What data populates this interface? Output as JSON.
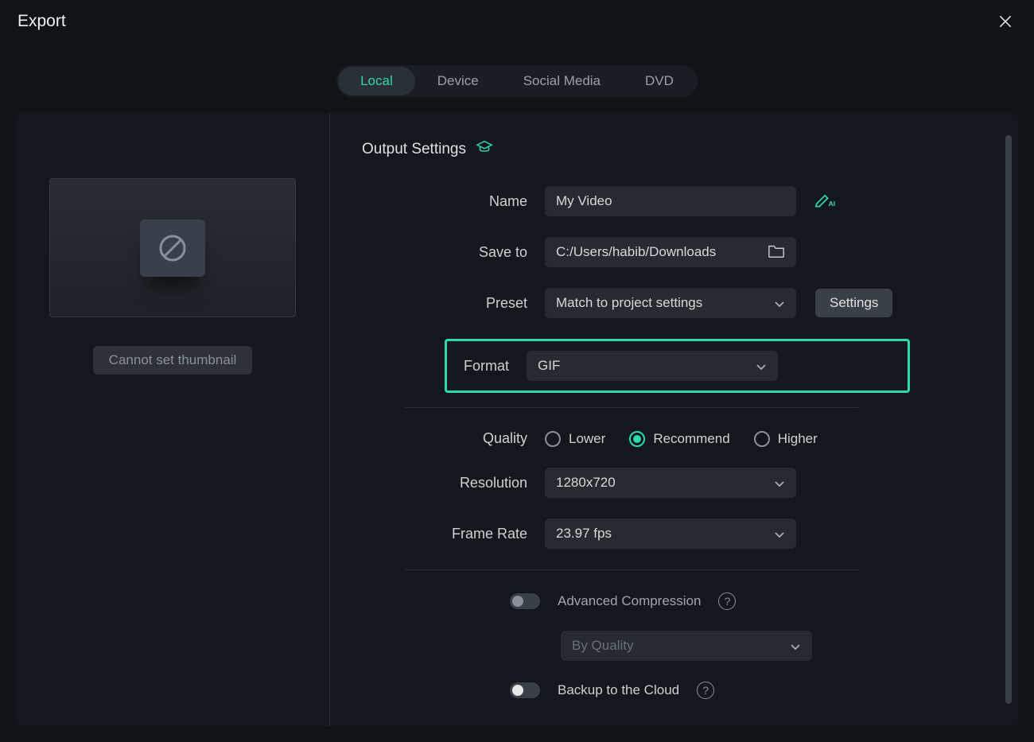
{
  "window": {
    "title": "Export"
  },
  "tabs": {
    "local": "Local",
    "device": "Device",
    "social": "Social Media",
    "dvd": "DVD",
    "active": "local"
  },
  "thumbnail": {
    "button": "Cannot set thumbnail"
  },
  "sectionTitle": "Output Settings",
  "labels": {
    "name": "Name",
    "saveTo": "Save to",
    "preset": "Preset",
    "format": "Format",
    "quality": "Quality",
    "resolution": "Resolution",
    "frameRate": "Frame Rate"
  },
  "fields": {
    "name": "My Video",
    "saveTo": "C:/Users/habib/Downloads",
    "preset": "Match to project settings",
    "format": "GIF",
    "resolution": "1280x720",
    "frameRate": "23.97 fps",
    "compressionMode": "By Quality"
  },
  "quality": {
    "lower": "Lower",
    "recommend": "Recommend",
    "higher": "Higher",
    "selected": "recommend"
  },
  "buttons": {
    "settings": "Settings"
  },
  "toggles": {
    "advCompression": {
      "label": "Advanced Compression",
      "on": false
    },
    "backupCloud": {
      "label": "Backup to the Cloud",
      "on": false
    }
  }
}
